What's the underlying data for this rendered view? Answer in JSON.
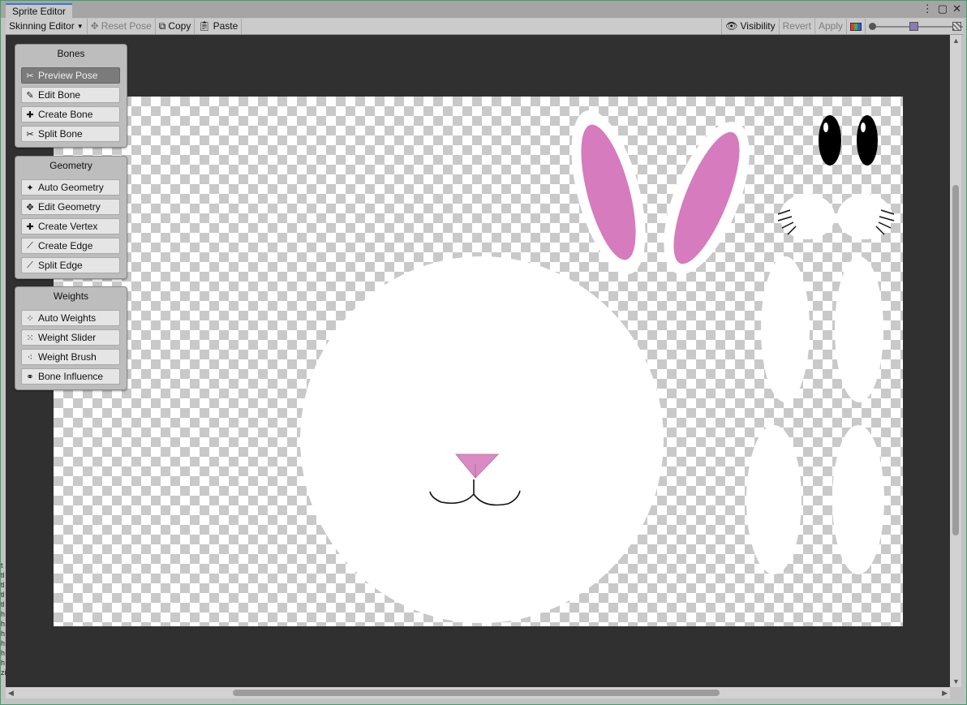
{
  "window": {
    "tab_title": "Sprite Editor",
    "menu_icon": "kebab-icon",
    "maximize_icon": "maximize-icon",
    "close_icon": "close-icon"
  },
  "toolbar": {
    "mode_label": "Skinning Editor",
    "reset_pose": "Reset Pose",
    "copy": "Copy",
    "paste": "Paste",
    "visibility": "Visibility",
    "revert": "Revert",
    "apply": "Apply"
  },
  "panels": {
    "bones": {
      "title": "Bones",
      "items": [
        {
          "label": "Preview Pose",
          "icon": "preview-pose-icon",
          "active": true
        },
        {
          "label": "Edit Bone",
          "icon": "edit-bone-icon"
        },
        {
          "label": "Create Bone",
          "icon": "create-bone-icon"
        },
        {
          "label": "Split Bone",
          "icon": "split-bone-icon"
        }
      ]
    },
    "geometry": {
      "title": "Geometry",
      "items": [
        {
          "label": "Auto Geometry",
          "icon": "auto-geometry-icon"
        },
        {
          "label": "Edit Geometry",
          "icon": "edit-geometry-icon"
        },
        {
          "label": "Create Vertex",
          "icon": "create-vertex-icon"
        },
        {
          "label": "Create Edge",
          "icon": "create-edge-icon"
        },
        {
          "label": "Split Edge",
          "icon": "split-edge-icon"
        }
      ]
    },
    "weights": {
      "title": "Weights",
      "items": [
        {
          "label": "Auto Weights",
          "icon": "auto-weights-icon"
        },
        {
          "label": "Weight Slider",
          "icon": "weight-slider-icon"
        },
        {
          "label": "Weight Brush",
          "icon": "weight-brush-icon"
        },
        {
          "label": "Bone Influence",
          "icon": "bone-influence-icon"
        }
      ]
    }
  },
  "colors": {
    "ear_pink": "#d67bbe",
    "nose_pink": "#d98bc4",
    "viewport_bg": "#303030"
  },
  "left_strip": [
    "t",
    "tl",
    "tl",
    "tl",
    "tl",
    "h",
    "h",
    "h",
    "h",
    "h",
    "h",
    "zi"
  ]
}
